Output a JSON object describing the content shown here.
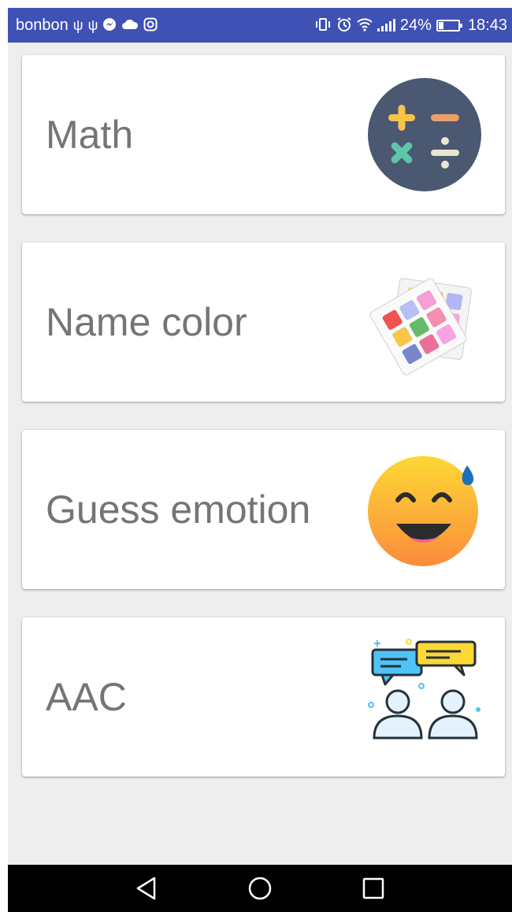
{
  "status_bar": {
    "carrier": "bonbon",
    "battery": "24%",
    "time": "18:43",
    "left_icons": [
      "usb-icon",
      "usb-icon",
      "messenger-icon",
      "cloud-icon",
      "instagram-icon"
    ],
    "right_icons": [
      "vibrate-icon",
      "alarm-icon",
      "wifi-icon",
      "signal-icon",
      "battery-charging-icon"
    ]
  },
  "menu": {
    "items": [
      {
        "label": "Math",
        "icon": "math-operations-icon"
      },
      {
        "label": "Name color",
        "icon": "color-cards-icon"
      },
      {
        "label": "Guess emotion",
        "icon": "smiling-sweat-emoji-icon"
      },
      {
        "label": "AAC",
        "icon": "people-chat-icon"
      }
    ]
  },
  "nav_bar": {
    "buttons": [
      "back-icon",
      "home-icon",
      "recents-icon"
    ]
  },
  "colors": {
    "status_bar": "#3f51b5",
    "background": "#eeeeee",
    "card": "#ffffff",
    "label_text": "#757575",
    "nav_bar": "#000000"
  }
}
